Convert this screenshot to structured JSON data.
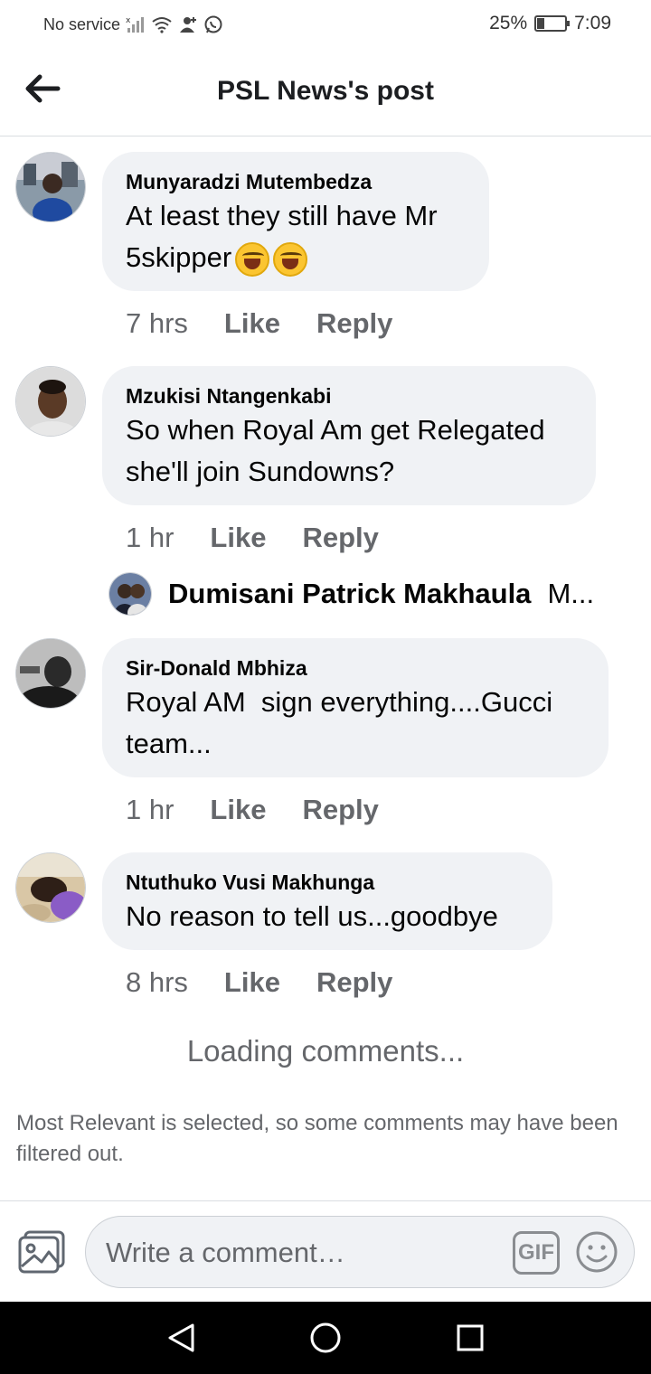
{
  "status_bar": {
    "carrier": "No service",
    "battery": "25%",
    "battery_level": 0.25,
    "time": "7:09"
  },
  "header": {
    "title": "PSL News's post"
  },
  "comments": [
    {
      "author": "Munyaradzi Mutembedza",
      "text_line1": "At least they still have Mr",
      "text_line2": "5skipper",
      "emojis": [
        "face-with-tears-of-joy-icon",
        "face-with-tears-of-joy-icon"
      ],
      "time": "7 hrs",
      "like": "Like",
      "reply": "Reply"
    },
    {
      "author": "Mzukisi Ntangenkabi",
      "text_line1": "So when Royal Am get Relegated",
      "text_line2": "she'll join Sundowns?",
      "time": "1 hr",
      "like": "Like",
      "reply": "Reply"
    },
    {
      "author": "Sir-Donald Mbhiza",
      "text_line1": "Royal AM  sign everything....Gucci",
      "text_line2": "team...",
      "time": "1 hr",
      "like": "Like",
      "reply": "Reply"
    },
    {
      "author": "Ntuthuko Vusi Makhunga",
      "text_line1": "No reason to tell us...goodbye",
      "time": "8 hrs",
      "like": "Like",
      "reply": "Reply"
    }
  ],
  "reply_preview": {
    "author": "Dumisani Patrick Makhaula",
    "snippet": "M..."
  },
  "loading": "Loading comments...",
  "filter_note": "Most Relevant is selected, so some comments may have been filtered out.",
  "composer": {
    "placeholder": "Write a comment…",
    "gif_label": "GIF"
  }
}
